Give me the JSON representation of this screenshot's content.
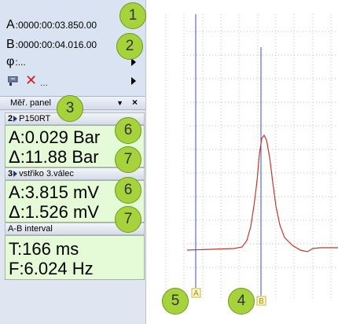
{
  "cursors": {
    "a_label": "A",
    "a_time": ":0000:00:03.850.00",
    "b_label": "B",
    "b_time": ":0000:00:04.016.00",
    "phi_label": "φ",
    "phi_value": ":...",
    "tool_row_text": "..."
  },
  "panel": {
    "title": "Měř. panel",
    "pin_icon": "pin-down-icon",
    "close_label": "×"
  },
  "sections": [
    {
      "index": "2",
      "name": "P150RT",
      "a_text": "A:0.029 Bar",
      "delta_text": "Δ:11.88 Bar"
    },
    {
      "index": "3",
      "name": "vstřiko 3.válec",
      "a_text": "A:3.815 mV",
      "delta_text": "Δ:1.526 mV"
    }
  ],
  "interval": {
    "title": "A-B interval",
    "t_text": "T:166 ms",
    "f_text": "F:6.024 Hz"
  },
  "badges": [
    "1",
    "2",
    "3",
    "6",
    "7",
    "6",
    "7",
    "5",
    "4"
  ],
  "cursor_markers": {
    "a": "A",
    "b": "B"
  },
  "colors": {
    "badge": "#a6d23c",
    "readout_bg": "#e5fad6",
    "cursor_line": "#3b4bd6",
    "signal": "#c0392b",
    "grid": "#bdbdbd"
  }
}
